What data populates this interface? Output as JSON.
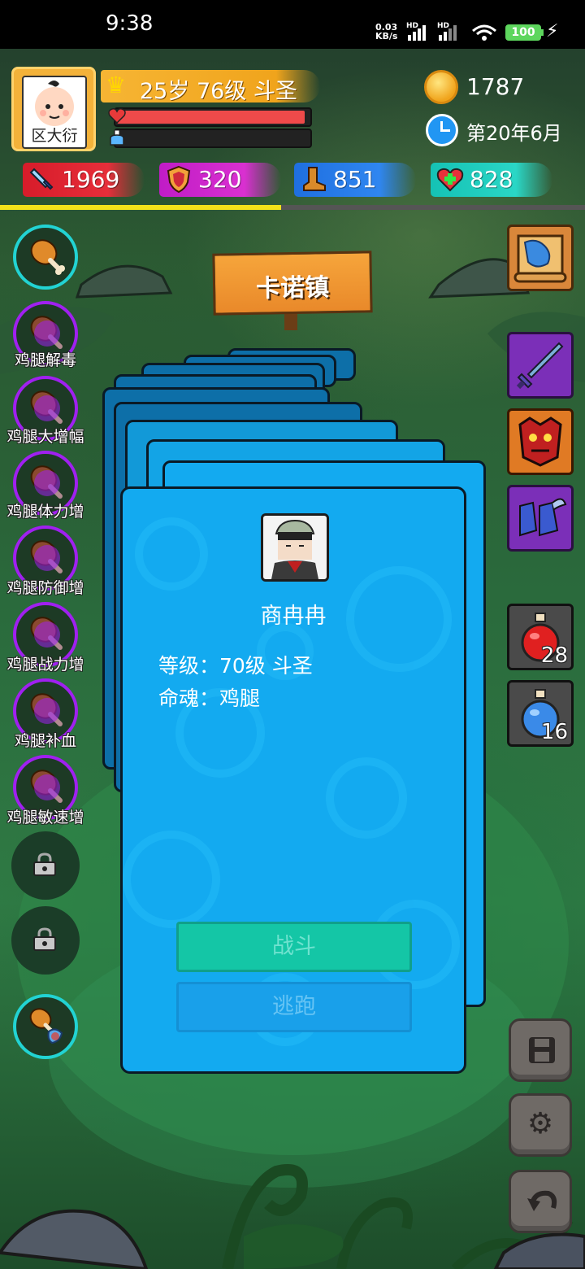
{
  "status_bar": {
    "time": "9:38",
    "net_speed": "0.03",
    "net_unit": "KB/s",
    "battery": "100"
  },
  "player": {
    "name": "区大衍",
    "level_text": "25岁 76级 斗圣",
    "hp_fraction": 0.98,
    "mp_fraction": 0.0,
    "exp_fraction": 0.48
  },
  "resources": {
    "gold": "1787",
    "date": "第20年6月"
  },
  "stats": {
    "attack": "1969",
    "defense": "320",
    "speed": "851",
    "health": "828"
  },
  "location": {
    "name": "卡诺镇"
  },
  "buffs": [
    {
      "label": ""
    },
    {
      "label": "鸡腿解毒"
    },
    {
      "label": "鸡腿大增幅"
    },
    {
      "label": "鸡腿体力增"
    },
    {
      "label": "鸡腿防御增"
    },
    {
      "label": "鸡腿战力增"
    },
    {
      "label": "鸡腿补血"
    },
    {
      "label": "鸡腿敏速增"
    }
  ],
  "potions": {
    "red_count": "28",
    "blue_count": "16"
  },
  "encounter": {
    "npc_name": "商冉冉",
    "level_line": "等级：70级 斗圣",
    "soul_line": "命魂：鸡腿",
    "fight_label": "战斗",
    "flee_label": "逃跑"
  },
  "colors": {
    "hp": "#ef4a4a",
    "mp": "#4aa3ef",
    "exp": "#f3e11a",
    "card": "#13aaf0"
  }
}
